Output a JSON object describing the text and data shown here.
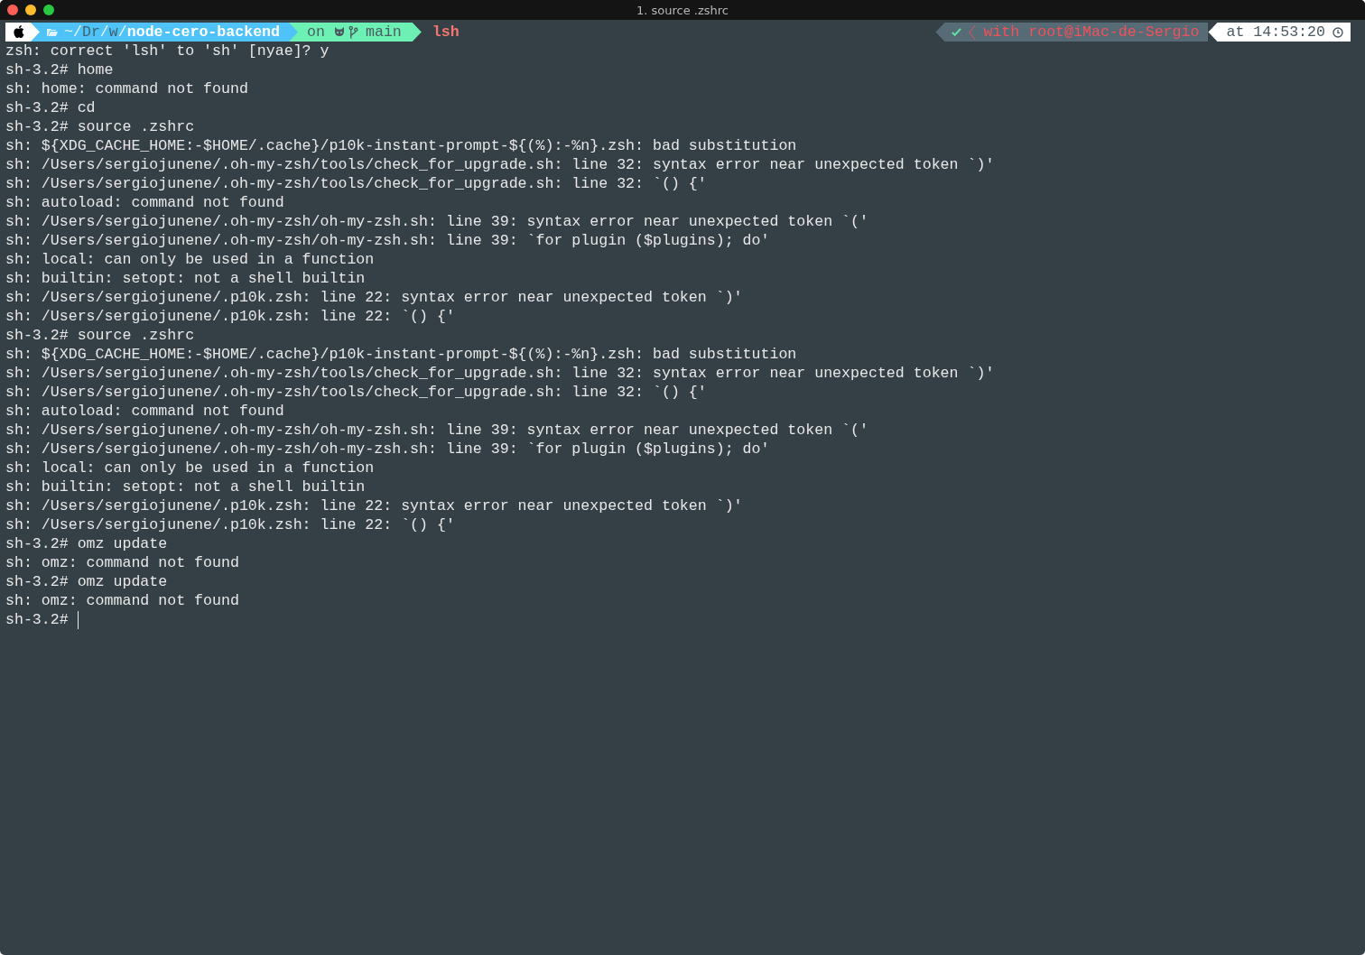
{
  "window": {
    "title": "1. source .zshrc"
  },
  "prompt_left": {
    "path": [
      {
        "text": "~/",
        "dim": false
      },
      {
        "text": "Dr",
        "dim": true
      },
      {
        "text": "/",
        "dim": false
      },
      {
        "text": "w",
        "dim": true
      },
      {
        "text": "/",
        "dim": false
      },
      {
        "text": "node-cero-backend",
        "dim": false,
        "bold": true
      }
    ],
    "vcs_label": "on",
    "branch": "main",
    "command": "lsh"
  },
  "prompt_right": {
    "status_ok": true,
    "context": "with root@iMac-de-Sergio",
    "time": "at 14:53:20"
  },
  "lines": [
    "zsh: correct 'lsh' to 'sh' [nyae]? y",
    "sh-3.2# home",
    "sh: home: command not found",
    "sh-3.2# cd",
    "sh-3.2# source .zshrc",
    "sh: ${XDG_CACHE_HOME:-$HOME/.cache}/p10k-instant-prompt-${(%):-%n}.zsh: bad substitution",
    "sh: /Users/sergiojunene/.oh-my-zsh/tools/check_for_upgrade.sh: line 32: syntax error near unexpected token `)'",
    "sh: /Users/sergiojunene/.oh-my-zsh/tools/check_for_upgrade.sh: line 32: `() {'",
    "sh: autoload: command not found",
    "sh: /Users/sergiojunene/.oh-my-zsh/oh-my-zsh.sh: line 39: syntax error near unexpected token `('",
    "sh: /Users/sergiojunene/.oh-my-zsh/oh-my-zsh.sh: line 39: `for plugin ($plugins); do'",
    "sh: local: can only be used in a function",
    "sh: builtin: setopt: not a shell builtin",
    "sh: /Users/sergiojunene/.p10k.zsh: line 22: syntax error near unexpected token `)'",
    "sh: /Users/sergiojunene/.p10k.zsh: line 22: `() {'",
    "sh-3.2# source .zshrc",
    "sh: ${XDG_CACHE_HOME:-$HOME/.cache}/p10k-instant-prompt-${(%):-%n}.zsh: bad substitution",
    "sh: /Users/sergiojunene/.oh-my-zsh/tools/check_for_upgrade.sh: line 32: syntax error near unexpected token `)'",
    "sh: /Users/sergiojunene/.oh-my-zsh/tools/check_for_upgrade.sh: line 32: `() {'",
    "sh: autoload: command not found",
    "sh: /Users/sergiojunene/.oh-my-zsh/oh-my-zsh.sh: line 39: syntax error near unexpected token `('",
    "sh: /Users/sergiojunene/.oh-my-zsh/oh-my-zsh.sh: line 39: `for plugin ($plugins); do'",
    "sh: local: can only be used in a function",
    "sh: builtin: setopt: not a shell builtin",
    "sh: /Users/sergiojunene/.p10k.zsh: line 22: syntax error near unexpected token `)'",
    "sh: /Users/sergiojunene/.p10k.zsh: line 22: `() {'",
    "sh-3.2# omz update",
    "sh: omz: command not found",
    "sh-3.2# omz update",
    "sh: omz: command not found"
  ],
  "input_line": {
    "prompt": "sh-3.2#",
    "cursor": true
  }
}
